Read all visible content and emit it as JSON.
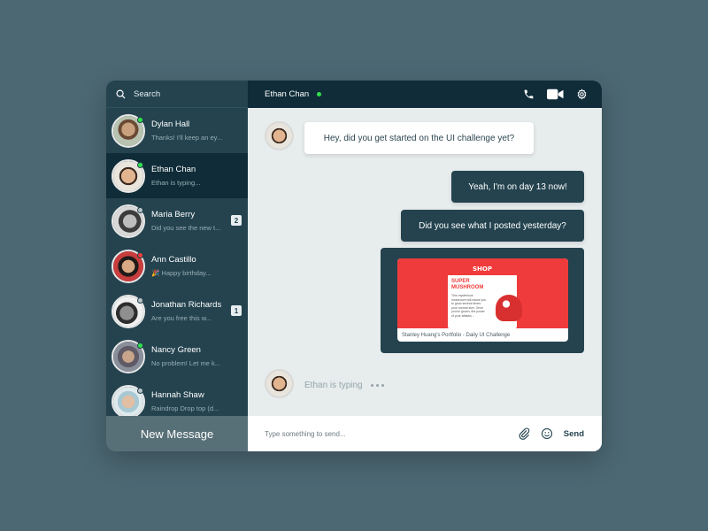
{
  "sidebar": {
    "search_label": "Search",
    "new_message_label": "New Message",
    "contacts": [
      {
        "name": "Dylan Hall",
        "preview": "Thanks! I'll keep an ey...",
        "status_color": "#2ee34a",
        "badge": null
      },
      {
        "name": "Ethan Chan",
        "preview": "Ethan is typing...",
        "status_color": "#2ee34a",
        "badge": null
      },
      {
        "name": "Maria Berry",
        "preview": "Did you see the new t...",
        "status_color": "#b9c4c8",
        "badge": "2"
      },
      {
        "name": "Ann Castillo",
        "preview": "🎉 Happy birthday...",
        "status_color": "#ef3b3b",
        "badge": null
      },
      {
        "name": "Jonathan Richards",
        "preview": "Are you free this w...",
        "status_color": "#b9c4c8",
        "badge": "1"
      },
      {
        "name": "Nancy Green",
        "preview": "No problem! Let me k...",
        "status_color": "#2ee34a",
        "badge": null
      },
      {
        "name": "Hannah Shaw",
        "preview": "Raindrop Drop top (d...",
        "status_color": "#b9c4c8",
        "badge": null
      }
    ]
  },
  "header": {
    "contact_name": "Ethan Chan",
    "online_color": "#2ee34a",
    "icons": [
      "phone-icon",
      "video-camera-icon",
      "gear-icon"
    ]
  },
  "conversation": {
    "incoming_1": "Hey, did you get started on the UI challenge yet?",
    "outgoing_1": "Yeah, I'm on day 13 now!",
    "outgoing_2": "Did you see what I posted yesterday?",
    "attachment": {
      "caption": "Stanley Huang's Portfolio - Daily UI Challenge",
      "preview_logo": "SHOP",
      "preview_heading_1": "SUPER",
      "preview_heading_2": "MUSHROOM",
      "preview_body": "This mysterious mushroom will cause you to grow several times your normal size. Once you've grown, the power of your attacks..."
    },
    "typing_label": "Ethan is typing"
  },
  "composer": {
    "placeholder": "Type something to send...",
    "send_label": "Send"
  },
  "colors": {
    "background": "#4c6873",
    "sidebar": "#24434f",
    "header": "#0f2c38",
    "chat_bg": "#e7eced",
    "accent_red": "#ef3b3b"
  }
}
